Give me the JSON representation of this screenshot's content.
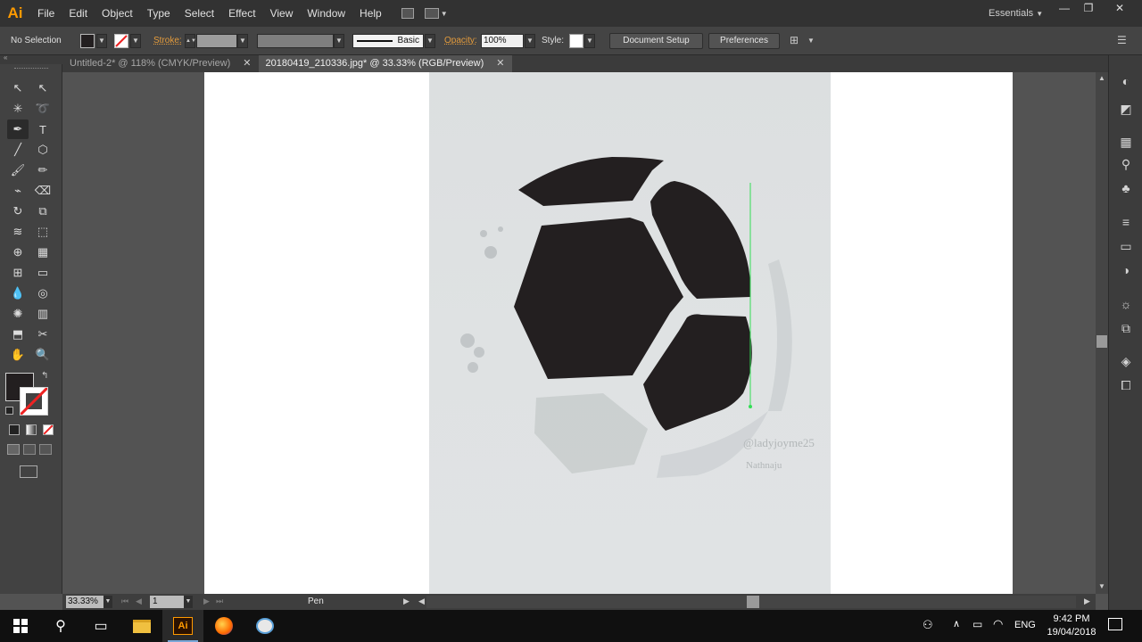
{
  "app": {
    "logo": "Ai",
    "workspace": "Essentials"
  },
  "menu": [
    "File",
    "Edit",
    "Object",
    "Type",
    "Select",
    "Effect",
    "View",
    "Window",
    "Help"
  ],
  "window_controls": {
    "minimize": "—",
    "restore": "❐",
    "close": "✕"
  },
  "control_bar": {
    "selection": "No Selection",
    "stroke_label": "Stroke:",
    "brush_label": "Basic",
    "opacity_label": "Opacity:",
    "opacity_value": "100%",
    "style_label": "Style:",
    "document_setup": "Document Setup",
    "preferences": "Preferences"
  },
  "tabs": [
    {
      "label": "Untitled-2* @ 118% (CMYK/Preview)",
      "close": "✕"
    },
    {
      "label": "20180419_210336.jpg* @ 33.33% (RGB/Preview)",
      "close": "✕"
    }
  ],
  "status_bar": {
    "zoom": "33.33%",
    "artboard_number": "1",
    "tool": "Pen"
  },
  "artwork": {
    "signature_1": "@ladyjoyme25",
    "signature_2": "Nathnaju"
  },
  "taskbar": {
    "language": "ENG",
    "time": "9:42 PM",
    "date": "19/04/2018"
  },
  "colors": {
    "accent_orange": "#ff9a00",
    "path_guide": "#33dd55",
    "ball_dark": "#231f20"
  }
}
